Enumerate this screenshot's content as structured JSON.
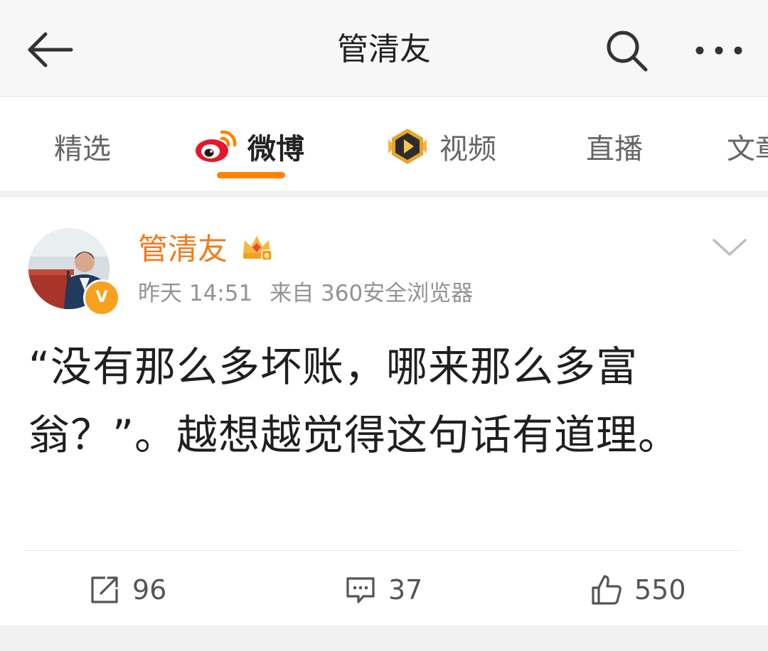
{
  "header": {
    "title": "管清友",
    "back_icon": "back-arrow-icon",
    "search_icon": "search-icon",
    "more_icon": "more-dots-icon"
  },
  "tabs": [
    {
      "label": "精选",
      "icon": null,
      "active": false
    },
    {
      "label": "微博",
      "icon": "weibo-logo-icon",
      "active": true
    },
    {
      "label": "视频",
      "icon": "video-badge-icon",
      "active": false
    },
    {
      "label": "直播",
      "icon": null,
      "active": false
    },
    {
      "label": "文章",
      "icon": null,
      "active": false
    }
  ],
  "post": {
    "author": "管清友",
    "verified_badge": "V",
    "time": "昨天 14:51",
    "source": "来自 360安全浏览器",
    "text": "“没有那么多坏账，哪来那么多富翁？”。越想越觉得这句话有道理。",
    "actions": {
      "repost": {
        "icon": "repost-icon",
        "count": "96"
      },
      "comment": {
        "icon": "comment-icon",
        "count": "37"
      },
      "like": {
        "icon": "like-icon",
        "count": "550"
      }
    }
  },
  "colors": {
    "accent": "#ff8200",
    "username": "#f17a1a",
    "meta": "#939393",
    "text": "#1f1f1f"
  }
}
